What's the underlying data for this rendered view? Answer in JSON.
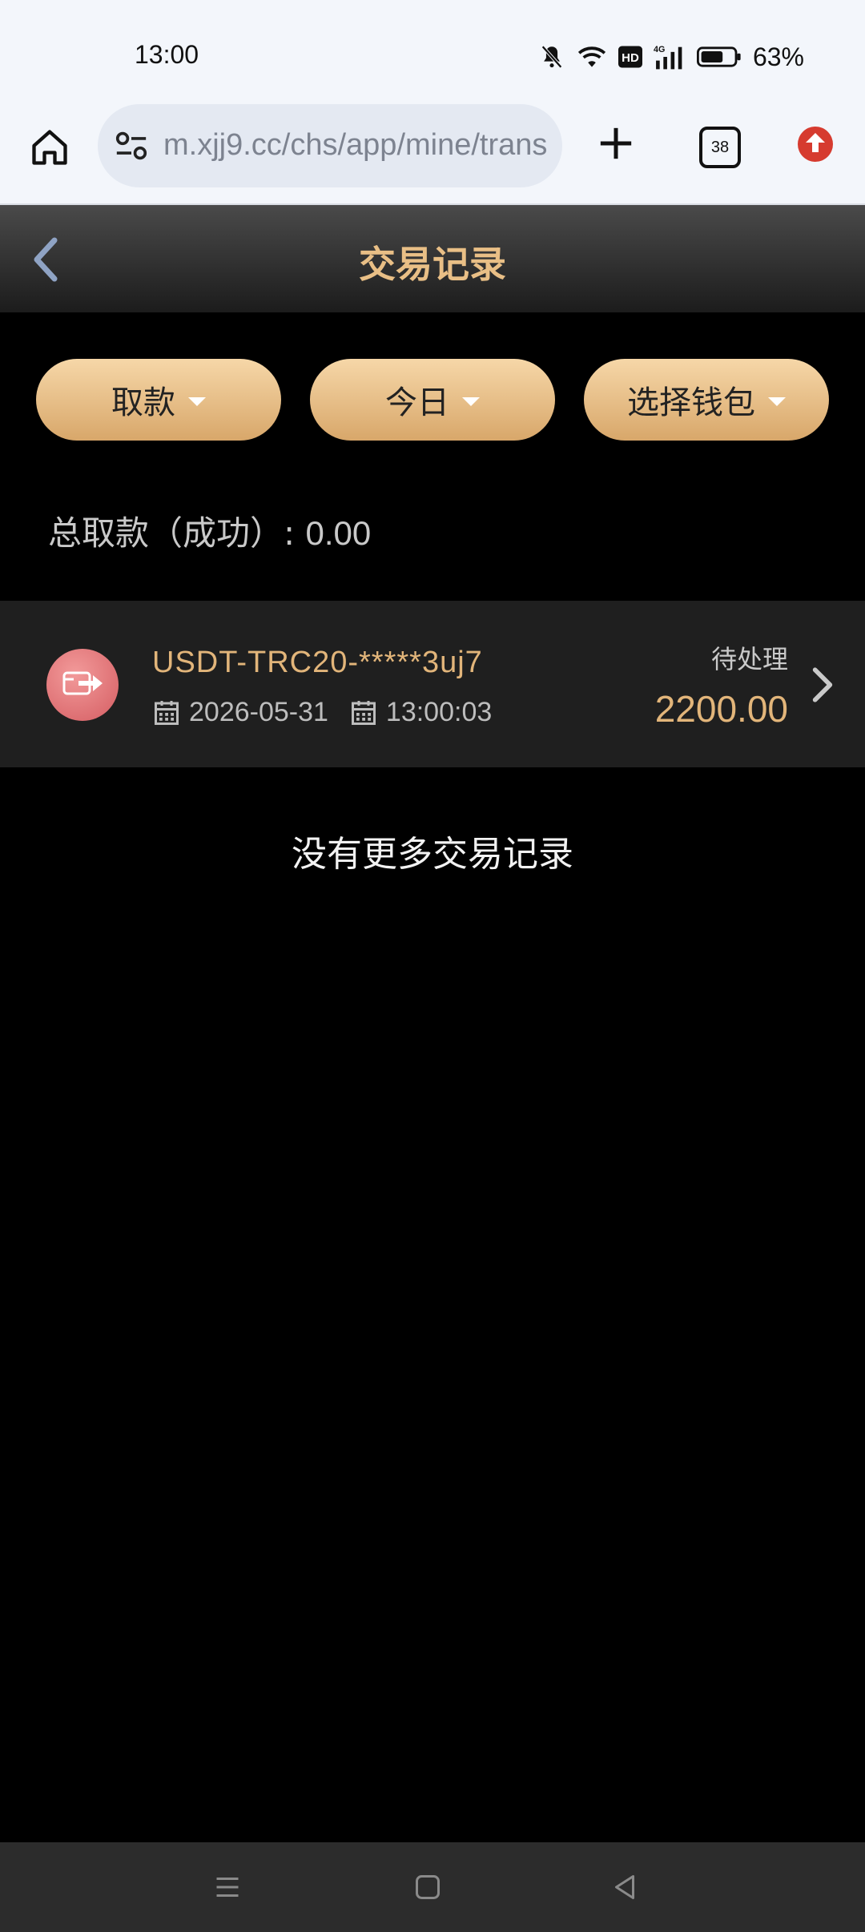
{
  "status_bar": {
    "time": "13:00",
    "battery": "63%",
    "icons": [
      "bell-muted-icon",
      "wifi-icon",
      "hd-icon",
      "4g-signal-icon",
      "battery-icon"
    ]
  },
  "browser": {
    "url": "m.xjj9.cc/chs/app/mine/trans",
    "tab_count": "38",
    "icons": [
      "home-icon",
      "site-settings-icon",
      "new-tab-plus-icon",
      "tabs-icon",
      "update-arrow-icon"
    ]
  },
  "header": {
    "title": "交易记录",
    "back_icon": "chevron-left-icon"
  },
  "filters": [
    {
      "label": "取款"
    },
    {
      "label": "今日"
    },
    {
      "label": "选择钱包"
    }
  ],
  "summary": {
    "label": "总取款（成功）:",
    "value": "0.00"
  },
  "transactions": [
    {
      "name": "USDT-TRC20-*****3uj7",
      "date": "2026-05-31",
      "time": "13:00:03",
      "status": "待处理",
      "amount": "2200.00"
    }
  ],
  "footer_text": "没有更多交易记录",
  "colors": {
    "accent_gold": "#e2b57a",
    "button_gold": "#e6bd84",
    "background": "#000000",
    "row_bg": "#1f1f1f",
    "withdraw_icon": "#d9656a"
  },
  "nav_icons": [
    "menu-icon",
    "home-square-icon",
    "back-triangle-icon"
  ]
}
